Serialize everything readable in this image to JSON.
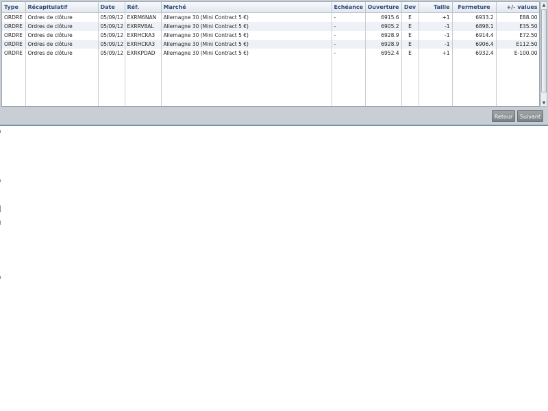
{
  "grid": {
    "columns": [
      {
        "key": "type",
        "label": "Type"
      },
      {
        "key": "recap",
        "label": "Récapitulatif"
      },
      {
        "key": "date",
        "label": "Date"
      },
      {
        "key": "ref",
        "label": "Réf."
      },
      {
        "key": "marche",
        "label": "Marché"
      },
      {
        "key": "echeance",
        "label": "Echéance"
      },
      {
        "key": "ouverture",
        "label": "Ouverture"
      },
      {
        "key": "dev",
        "label": "Dev"
      },
      {
        "key": "taille",
        "label": "Taille"
      },
      {
        "key": "fermeture",
        "label": "Fermeture"
      },
      {
        "key": "values",
        "label": "+/- values"
      }
    ],
    "rows": [
      {
        "type": "ORDRE",
        "recap": "Ordres de clôture",
        "date": "05/09/12",
        "ref": "EXRM6NAN",
        "marche": "Allemagne 30 (Mini Contract 5 €)",
        "echeance": "-",
        "ouverture": "6915.6",
        "dev": "E",
        "taille": "+1",
        "fermeture": "6933.2",
        "values": "E88.00"
      },
      {
        "type": "ORDRE",
        "recap": "Ordres de clôture",
        "date": "05/09/12",
        "ref": "EXRRV8AL",
        "marche": "Allemagne 30 (Mini Contract 5 €)",
        "echeance": "-",
        "ouverture": "6905.2",
        "dev": "E",
        "taille": "-1",
        "fermeture": "6898.1",
        "values": "E35.50"
      },
      {
        "type": "ORDRE",
        "recap": "Ordres de clôture",
        "date": "05/09/12",
        "ref": "EXRHCKA3",
        "marche": "Allemagne 30 (Mini Contract 5 €)",
        "echeance": "-",
        "ouverture": "6928.9",
        "dev": "E",
        "taille": "-1",
        "fermeture": "6914.4",
        "values": "E72.50"
      },
      {
        "type": "ORDRE",
        "recap": "Ordres de clôture",
        "date": "05/09/12",
        "ref": "EXRHCKA3",
        "marche": "Allemagne 30 (Mini Contract 5 €)",
        "echeance": "-",
        "ouverture": "6928.9",
        "dev": "E",
        "taille": "-1",
        "fermeture": "6906.4",
        "values": "E112.50"
      },
      {
        "type": "ORDRE",
        "recap": "Ordres de clôture",
        "date": "05/09/12",
        "ref": "EXRKPDAD",
        "marche": "Allemagne 30 (Mini Contract 5 €)",
        "echeance": "-",
        "ouverture": "6952.4",
        "dev": "E",
        "taille": "+1",
        "fermeture": "6932.4",
        "values": "E-100.00"
      }
    ]
  },
  "scrollbar": {
    "up_icon": "▲",
    "down_icon": "▼"
  },
  "buttons": {
    "retour": "Retour",
    "suivant": "Suivant"
  }
}
